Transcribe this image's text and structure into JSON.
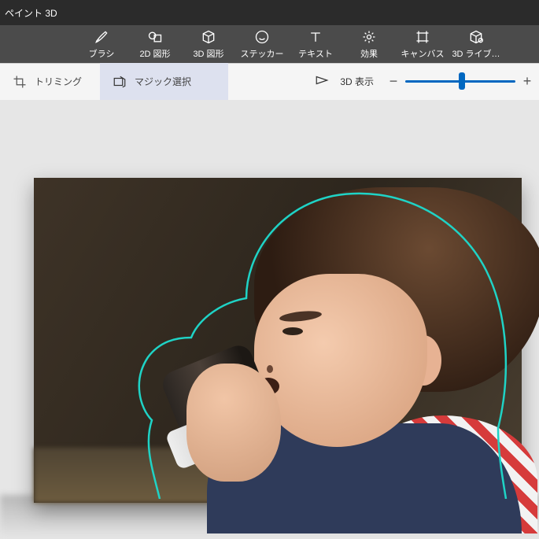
{
  "app": {
    "title": "ペイント 3D"
  },
  "toolbar": {
    "brush": {
      "label": "ブラシ",
      "icon": "brush-icon"
    },
    "shape2d": {
      "label": "2D 図形",
      "icon": "shape2d-icon"
    },
    "shape3d": {
      "label": "3D 図形",
      "icon": "shape3d-icon"
    },
    "sticker": {
      "label": "ステッカー",
      "icon": "sticker-icon"
    },
    "text": {
      "label": "テキスト",
      "icon": "text-icon"
    },
    "effects": {
      "label": "効果",
      "icon": "effects-icon"
    },
    "canvas": {
      "label": "キャンバス",
      "icon": "canvas-icon"
    },
    "library": {
      "label": "3D ライブ…",
      "icon": "library-icon"
    }
  },
  "subtoolbar": {
    "crop": {
      "label": "トリミング",
      "icon": "crop-icon"
    },
    "magicselect": {
      "label": "マジック選択",
      "icon": "magic-select-icon",
      "active": true
    },
    "view3d": {
      "label": "3D 表示",
      "icon": "view3d-icon"
    },
    "zoom": {
      "minus": "−",
      "plus": "+",
      "value_percent": 50
    }
  },
  "canvas": {
    "content_description": "写真：男の子が紙コップで飲み物を飲んでいる。被写体がマジック選択ツールで輪郭表示されている。",
    "selection_outline_color": "#1fd3c6"
  }
}
